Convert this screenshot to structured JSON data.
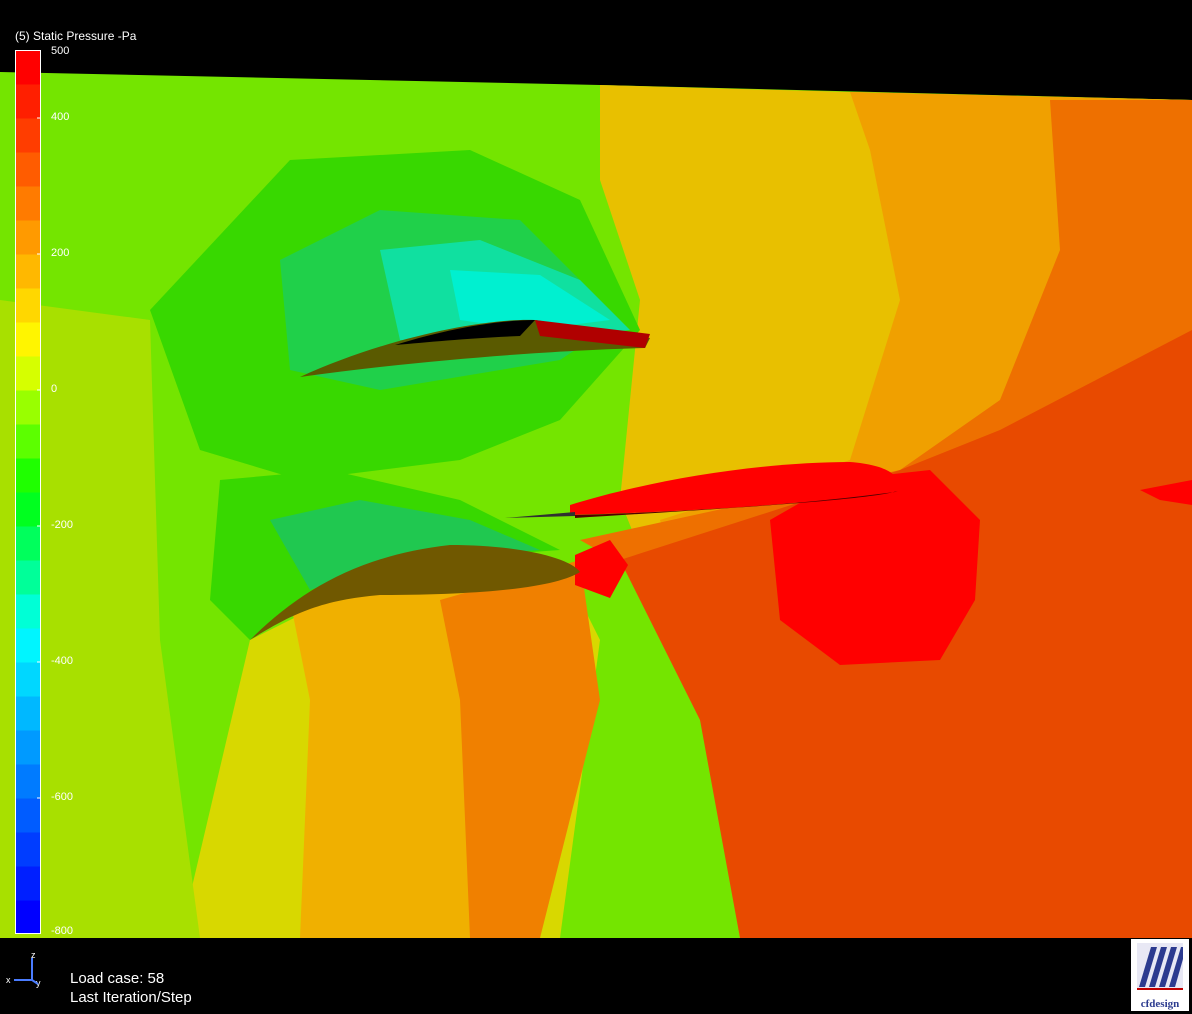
{
  "legend": {
    "title": "(5) Static Pressure -Pa",
    "ticks": [
      "500",
      "400",
      "200",
      "0",
      "-200",
      "-400",
      "-600",
      "-800"
    ],
    "tick_values": [
      500,
      400,
      200,
      0,
      -200,
      -400,
      -600,
      -800
    ],
    "range": [
      -800,
      500
    ],
    "bands": 26,
    "colors": [
      "#0000ff",
      "#0040ff",
      "#0080ff",
      "#00c0ff",
      "#00ffff",
      "#00ff80",
      "#00ff00",
      "#80ff00",
      "#ffff00",
      "#ffc000",
      "#ff8000",
      "#ff4000",
      "#ff0000"
    ]
  },
  "status": {
    "load_case": "Load case: 58",
    "step": "Last Iteration/Step"
  },
  "axes_triad": {
    "z": "z",
    "x": "x",
    "y": "y"
  },
  "logo": {
    "text": "cfdesign"
  }
}
